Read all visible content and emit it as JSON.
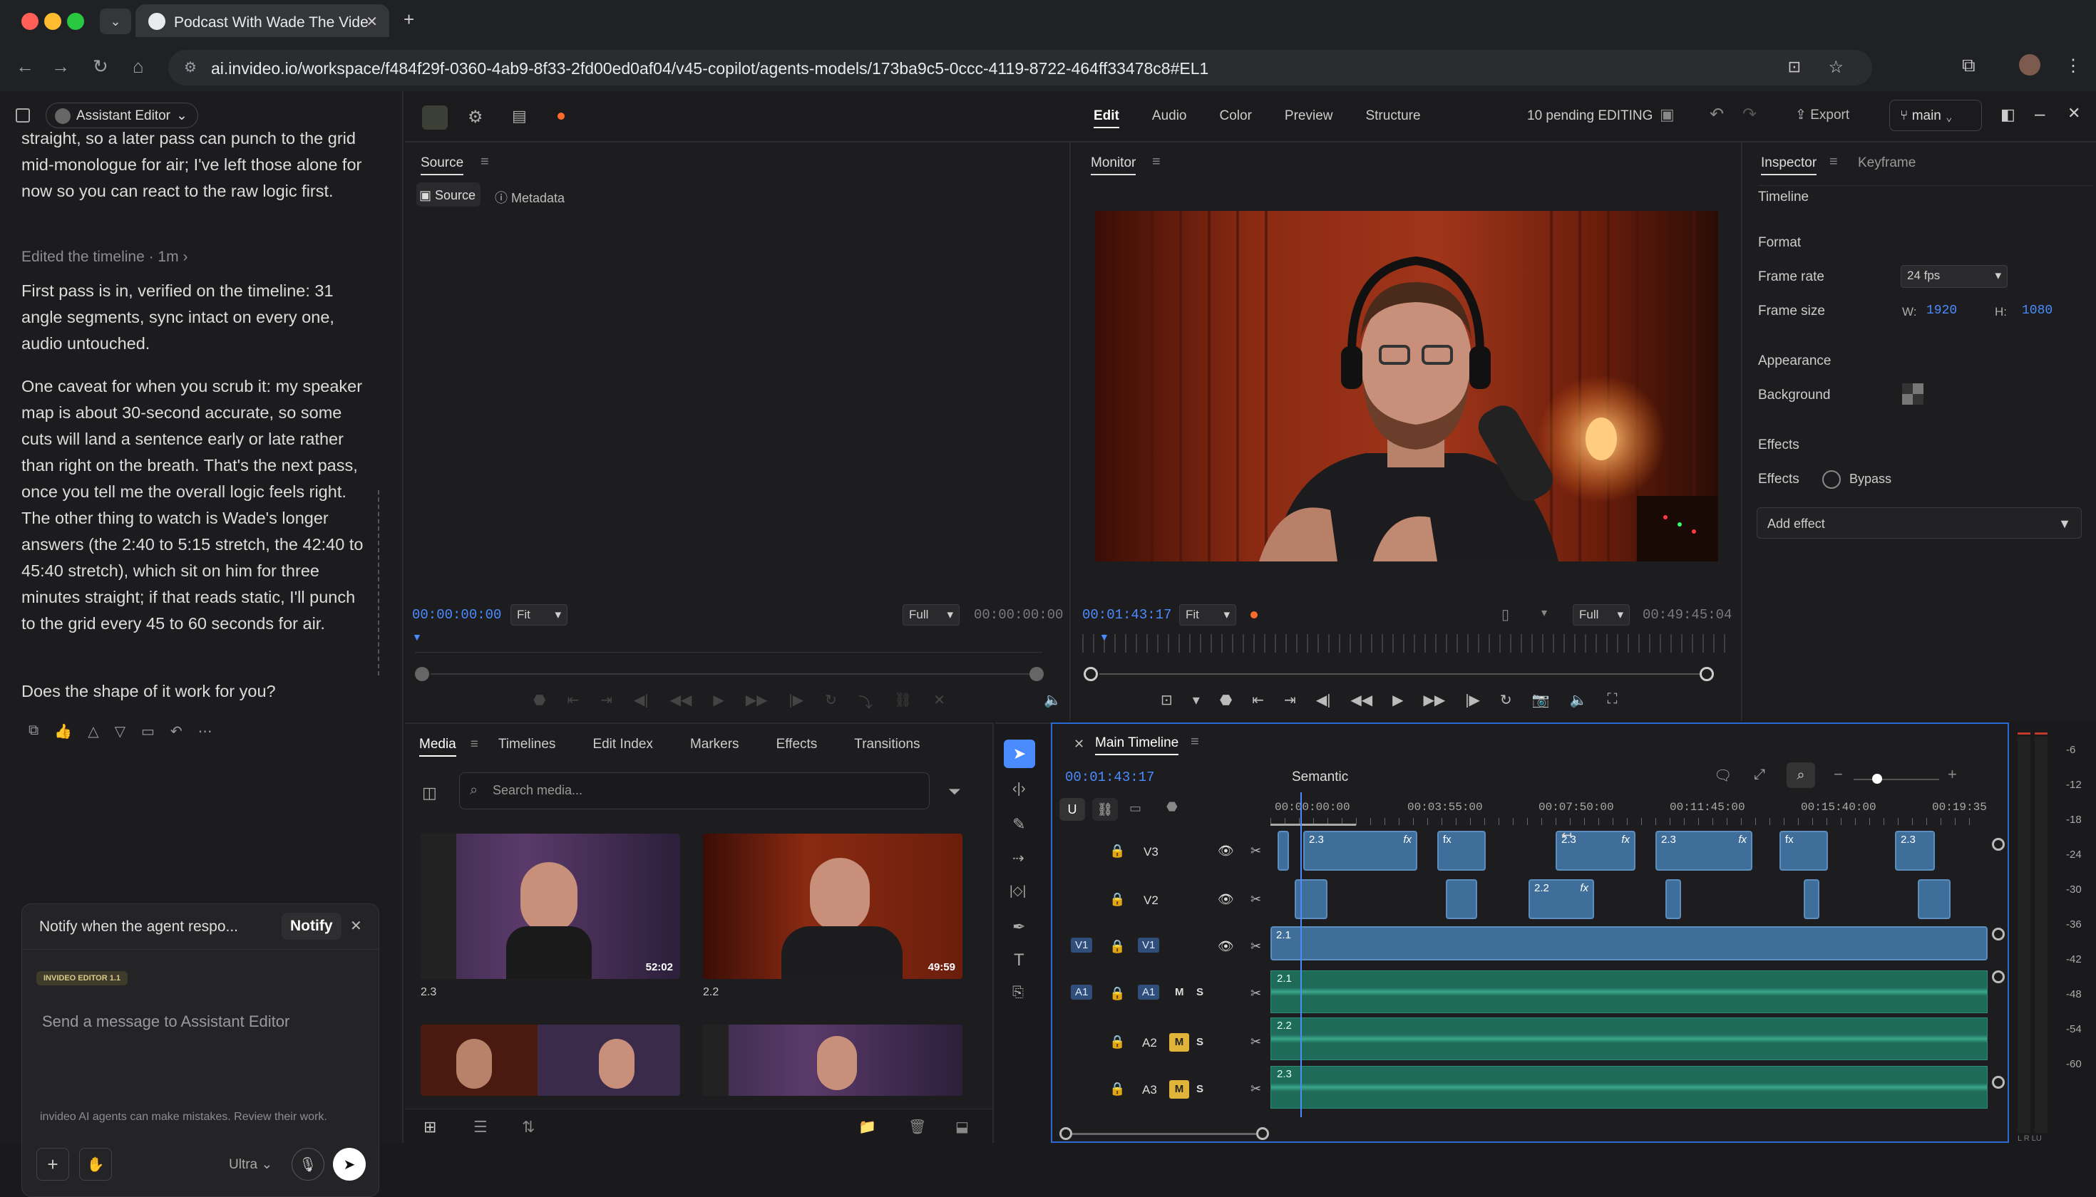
{
  "browser": {
    "tab_title": "Podcast With Wade The Vide",
    "url": "ai.invideo.io/workspace/f484f29f-0360-4ab9-8f33-2fd00ed0af04/v45-copilot/agents-models/173ba9c5-0ccc-4119-8722-464ff33478c8#EL1"
  },
  "assistant": {
    "selector_label": "Assistant Editor",
    "msg_partial": "straight, so a later pass can punch to the grid mid-monologue for air; I've left those alone for now so you can react to the raw logic first.",
    "status_line": "Edited the timeline · 1m",
    "msg1": "First pass is in, verified on the timeline: 31 angle segments, sync intact on every one, audio untouched.",
    "msg2": "One caveat for when you scrub it: my speaker map is about 30-second accurate, so some cuts will land a sentence early or late rather than right on the breath. That's the next pass, once you tell me the overall logic feels right. The other thing to watch is Wade's longer answers (the 2:40 to 5:15 stretch, the 42:40 to 45:40 stretch), which sit on him for three minutes straight; if that reads static, I'll punch to the grid every 45 to 60 seconds for air.",
    "msg3": "Does the shape of it work for you?",
    "notify_text": "Notify when the agent respo...",
    "notify_button": "Notify",
    "badge": "INVIDEO EDITOR 1.1",
    "input_placeholder": "Send a message to Assistant Editor",
    "model": "Ultra",
    "disclaimer": "invideo AI agents can make mistakes. Review their work."
  },
  "topbar": {
    "tabs": [
      "Edit",
      "Audio",
      "Color",
      "Preview",
      "Structure"
    ],
    "active_tab": "Edit",
    "pending": "10 pending EDITING",
    "export": "Export",
    "branch": "main"
  },
  "source_panel": {
    "title": "Source",
    "subtabs": [
      "Source",
      "Metadata"
    ],
    "timecode_left": "00:00:00:00",
    "fit": "Fit",
    "full": "Full",
    "timecode_right": "00:00:00:00"
  },
  "monitor_panel": {
    "title": "Monitor",
    "timecode_left": "00:01:43:17",
    "fit": "Fit",
    "full": "Full",
    "timecode_right": "00:49:45:04"
  },
  "inspector": {
    "tabs": [
      "Inspector",
      "Keyframe"
    ],
    "section_timeline": "Timeline",
    "format": "Format",
    "frame_rate_label": "Frame rate",
    "frame_rate": "24 fps",
    "frame_size_label": "Frame size",
    "w_label": "W:",
    "w": "1920",
    "h_label": "H:",
    "h": "1080",
    "appearance": "Appearance",
    "background_label": "Background",
    "effects_header": "Effects",
    "effects_label": "Effects",
    "bypass": "Bypass",
    "add_effect": "Add effect"
  },
  "media": {
    "tabs": [
      "Media",
      "Timelines",
      "Edit Index",
      "Markers",
      "Effects",
      "Transitions"
    ],
    "search_placeholder": "Search media...",
    "items": [
      {
        "label": "2.3",
        "duration": "52:02"
      },
      {
        "label": "2.2",
        "duration": "49:59"
      },
      {
        "label": "",
        "duration": ""
      },
      {
        "label": "",
        "duration": ""
      }
    ]
  },
  "timeline": {
    "title": "Main Timeline",
    "timecode": "00:01:43:17",
    "mode": "Semantic",
    "ruler": [
      "00:00:00:00",
      "00:03:55:00",
      "00:07:50:00",
      "00:11:45:00",
      "00:15:40:00",
      "00:19:35"
    ],
    "tracks": [
      {
        "name": "V3"
      },
      {
        "name": "V2"
      },
      {
        "name": "V1",
        "tag": "V1"
      },
      {
        "name": "A1",
        "tag": "A1",
        "m": "M",
        "s": "S"
      },
      {
        "name": "A2",
        "m": "M",
        "s": "S"
      },
      {
        "name": "A3",
        "m": "M",
        "s": "S"
      }
    ],
    "v3_clips": [
      "2.3",
      "2.3",
      "2.3",
      "2.3",
      "2.3"
    ],
    "v2_clips": [
      "2.2"
    ],
    "v1_clip": "2.1",
    "audio_clips": [
      "2.1",
      "2.2",
      "2.3"
    ]
  },
  "meter": {
    "labels": [
      "-6",
      "-12",
      "-18",
      "-24",
      "-30",
      "-36",
      "-42",
      "-48",
      "-54",
      "-60"
    ],
    "footer": "L  R  LU"
  },
  "colors": {
    "accent": "#4a8cff",
    "record": "#ff6b2b",
    "audio_clip": "#1f6b5a",
    "video_clip": "#3f6e9a",
    "mute_yellow": "#e0b33a"
  }
}
